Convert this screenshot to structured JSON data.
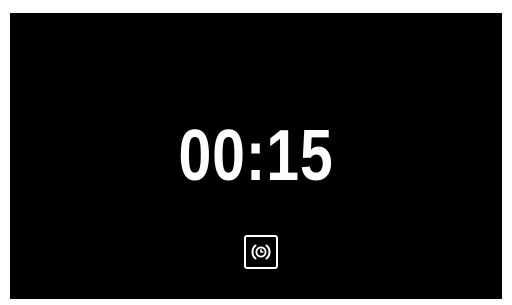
{
  "timer": {
    "display": "00:15"
  },
  "icon": {
    "name": "timer-alarm-icon"
  },
  "colors": {
    "background": "#000000",
    "foreground": "#ffffff"
  }
}
